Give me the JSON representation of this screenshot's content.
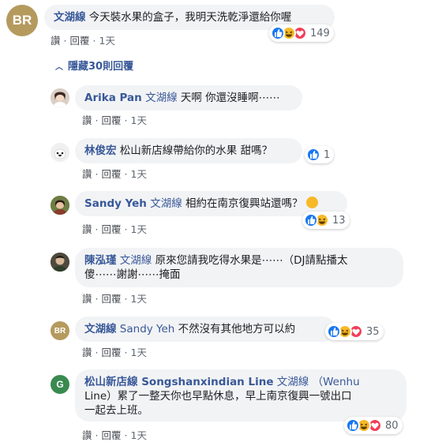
{
  "colors": {
    "link": "#385898",
    "bubble": "#f2f3f5",
    "like": "#1877f2",
    "haha": "#f7b928",
    "love": "#f33e58"
  },
  "main_comment": {
    "avatar_text": "BR",
    "author": "文湖線",
    "text": "今天裝水果的盒子，我明天洗乾淨還給你喔",
    "reply_label": "讚",
    "reaction_label": "回覆",
    "time": "1天",
    "reaction_count": "149",
    "reactions": [
      "like-icon",
      "haha-icon",
      "love-icon"
    ]
  },
  "toggle": {
    "label": "隱藏30則回覆"
  },
  "replies": [
    {
      "author": "Arika Pan",
      "mention": "文湖線",
      "text": "天啊 你還沒睡啊⋯⋯",
      "like_label": "讚",
      "reply_label": "回覆",
      "time": "1天"
    },
    {
      "author": "林俊宏",
      "mention": "",
      "text": "松山新店線帶給你的水果 甜嗎？",
      "like_label": "讚",
      "reply_label": "回覆",
      "time": "1天",
      "reaction_count": "1",
      "reactions": [
        "like-icon"
      ]
    },
    {
      "author": "Sandy Yeh",
      "mention": "文湖線",
      "text": "相約在南京復興站還嗎？",
      "like_label": "讚",
      "reply_label": "回覆",
      "time": "1天",
      "reaction_count": "13",
      "reactions": [
        "like-icon",
        "haha-icon"
      ]
    },
    {
      "author": "陳泓瑾",
      "mention": "文湖線",
      "text_line1": "原來您請我吃得水果是⋯⋯（DJ請點播太",
      "text_line2": "傻⋯⋯謝謝⋯⋯掩面",
      "like_label": "讚",
      "reply_label": "回覆",
      "time": "1天"
    },
    {
      "avatar_text": "BR",
      "author": "文湖線",
      "mention": "Sandy Yeh",
      "text": "不然沒有其他地方可以約",
      "like_label": "讚",
      "reply_label": "回覆",
      "time": "1天",
      "reaction_count": "35",
      "reactions": [
        "like-icon",
        "haha-icon",
        "love-icon"
      ]
    },
    {
      "avatar_text": "G",
      "author": "松山新店線 Songshanxindian Line",
      "mention": "文湖線",
      "mention2": "（Wenhu",
      "text_line1": "Line）累了一整天你也早點休息，早上南京復興一號出口",
      "text_line2": "一起去上班。",
      "like_label": "讚",
      "reply_label": "回覆",
      "time": "1天",
      "reaction_count": "80",
      "reactions": [
        "like-icon",
        "haha-icon",
        "love-icon"
      ]
    }
  ]
}
